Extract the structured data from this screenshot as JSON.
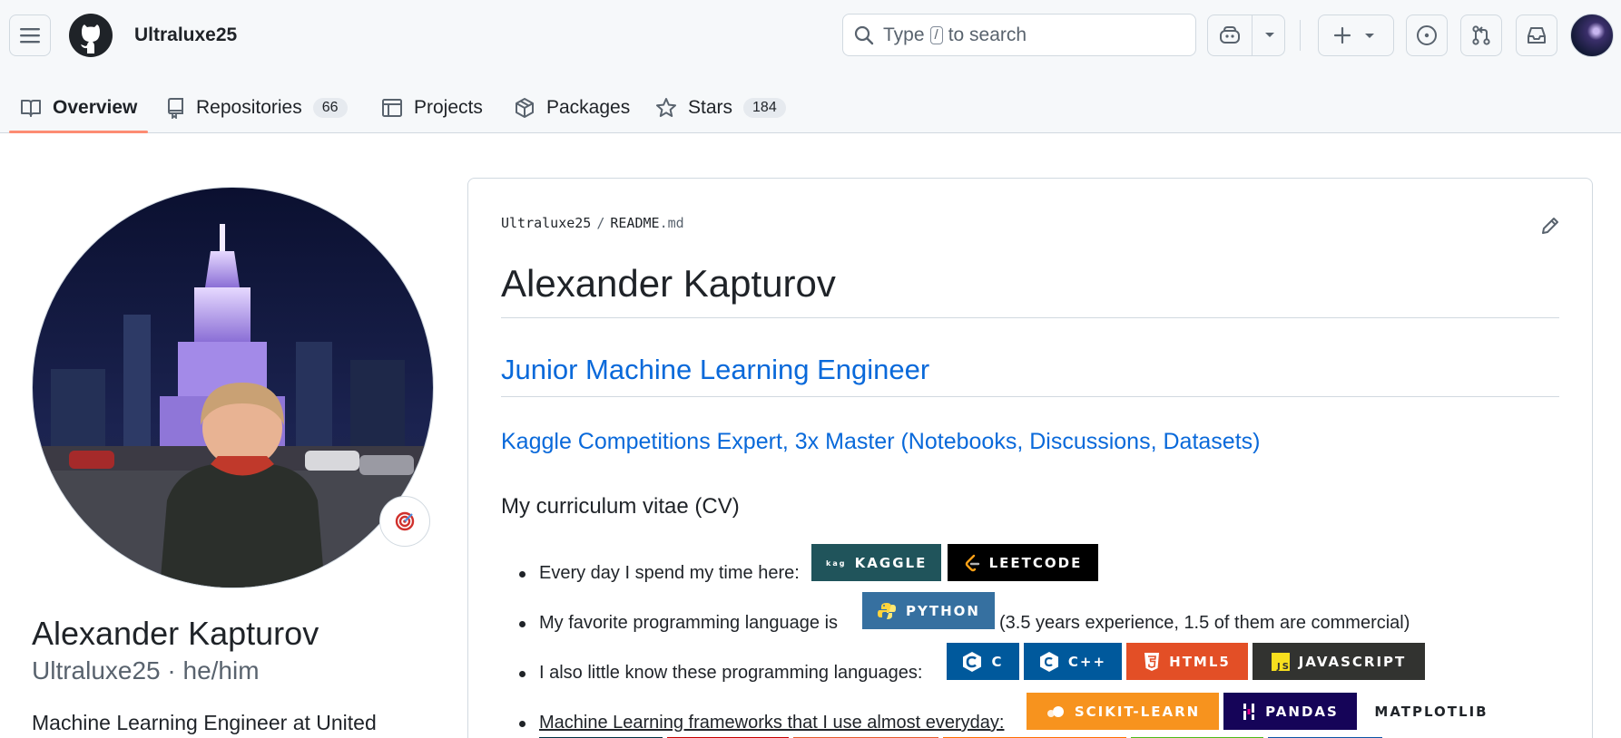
{
  "header": {
    "owner": "Ultraluxe25",
    "search": {
      "prefix": "Type",
      "key": "/",
      "suffix": "to search"
    }
  },
  "tabs": [
    {
      "label": "Overview",
      "active": true
    },
    {
      "label": "Repositories",
      "count": "66"
    },
    {
      "label": "Projects"
    },
    {
      "label": "Packages"
    },
    {
      "label": "Stars",
      "count": "184"
    }
  ],
  "profile": {
    "full_name": "Alexander Kapturov",
    "login_line": "Ultraluxe25 · he/him",
    "bio": "Machine Learning Engineer at United"
  },
  "readme": {
    "path_owner": "Ultraluxe25",
    "path_file": "README",
    "path_ext": ".md",
    "h1": "Alexander Kapturov",
    "h2": "Junior Machine Learning Engineer",
    "h3": "Kaggle Competitions Expert, 3x Master (Notebooks, Discussions, Datasets)",
    "h4": "My curriculum vitae (CV)",
    "items": [
      {
        "text": "Every day I spend my time here:"
      },
      {
        "text": "My favorite programming language is",
        "tail": "(3.5 years experience, 1.5 of them are commercial)"
      },
      {
        "text": "I also little know these programming languages:"
      },
      {
        "text": "Machine Learning frameworks that I use almost everyday:"
      }
    ],
    "badges": {
      "kaggle": "KAGGLE",
      "leetcode": "LEETCODE",
      "python": "PYTHON",
      "c": "C",
      "cpp": "C++",
      "html": "HTML5",
      "js": "JAVASCRIPT",
      "sklearn": "SCIKIT-LEARN",
      "pandas": "PANDAS",
      "matplotlib": "MATPLOTLIB"
    }
  },
  "colors": {
    "accent_link": "#0969da",
    "tab_underline": "#fd8c73",
    "kaggle": "#20545b",
    "leetcode": "#000000",
    "python": "#3670a0",
    "cpp": "#00599c",
    "html5": "#e34f26",
    "javascript": "#323330",
    "scikit_learn": "#f7931e",
    "pandas": "#150458"
  }
}
